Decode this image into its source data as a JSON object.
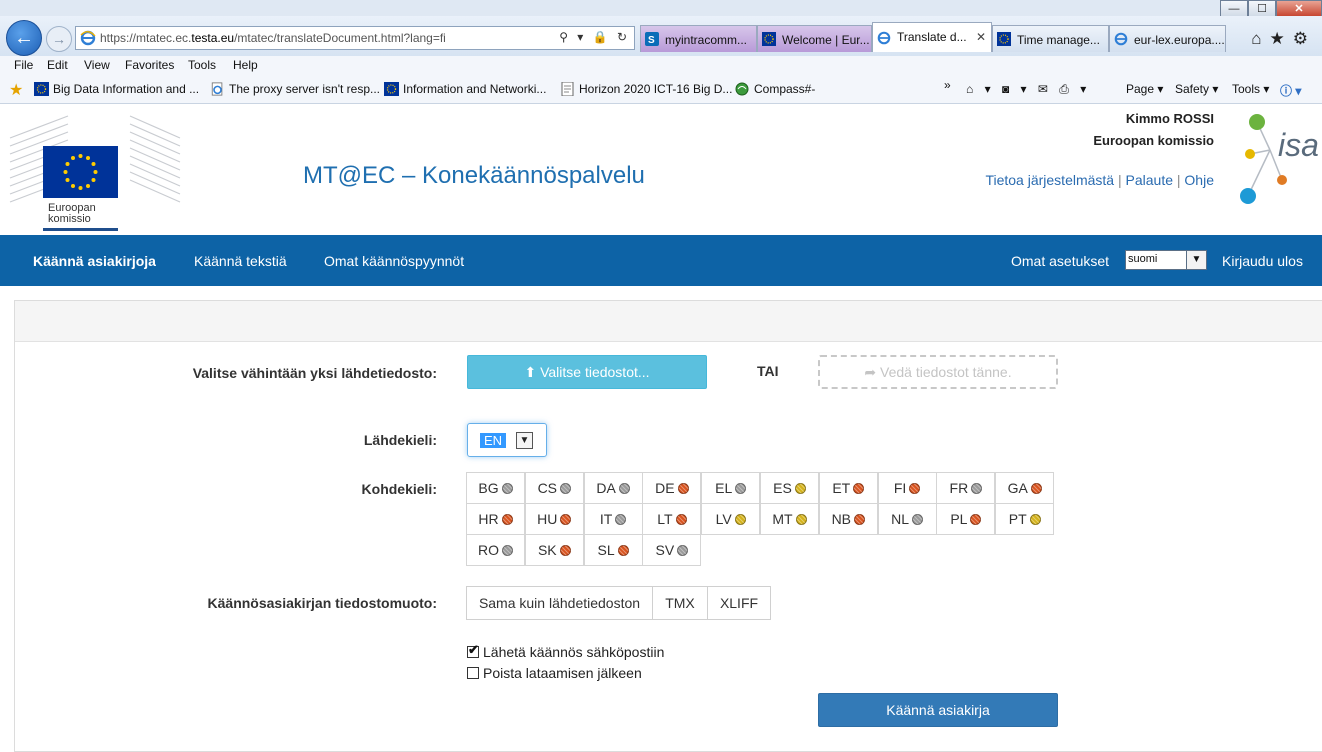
{
  "browser": {
    "url_prefix": "https://mtatec.ec.",
    "url_host": "testa.eu",
    "url_rest": "/mtatec/translateDocument.html?lang=fi",
    "addr_icons": "⚲ ▾ 🔒 ↻",
    "tabs": [
      {
        "label": "myintracomm...",
        "style": "purple",
        "fav": "sharepoint"
      },
      {
        "label": "Welcome | Eur...",
        "style": "purple",
        "fav": "eu"
      },
      {
        "label": "Translate d...",
        "style": "active",
        "fav": "ie",
        "close": "✕"
      },
      {
        "label": "Time manage...",
        "style": "normal",
        "fav": "eu"
      },
      {
        "label": "eur-lex.europa....",
        "style": "normal",
        "fav": "ie"
      }
    ],
    "window_buttons": {
      "minimize": "—",
      "maximize": "☐",
      "close": "✕"
    },
    "right_tools": "⌂★⚙",
    "menu": [
      "File",
      "Edit",
      "View",
      "Favorites",
      "Tools",
      "Help"
    ],
    "favorites": [
      {
        "label": "Big Data Information and ...",
        "icon": "eu"
      },
      {
        "label": "The proxy server isn't resp...",
        "icon": "ie"
      },
      {
        "label": "Information and Networki...",
        "icon": "eu"
      },
      {
        "label": "Horizon 2020 ICT-16 Big D...",
        "icon": "doc"
      },
      {
        "label": "Compass#-",
        "icon": "globe"
      }
    ],
    "chevron": "»",
    "command_bar": [
      "Page ▾",
      "Safety ▾",
      "Tools ▾"
    ],
    "command_icons": "⌂ ▾ ◙ ▾ ✉ ⎙ ▾"
  },
  "header": {
    "ec_logo_text": [
      "Euroopan",
      "komissio"
    ],
    "title": "MT@EC – Konekäännöspalvelu",
    "user_name": "Kimmo ROSSI",
    "user_org": "Euroopan komissio",
    "links": [
      "Tietoa järjestelmästä",
      "Palaute",
      "Ohje"
    ],
    "link_sep": "|",
    "isa_logo_text": "isa"
  },
  "nav": {
    "items": [
      "Käännä asiakirjoja",
      "Käännä tekstiä",
      "Omat käännöspyynnöt"
    ],
    "settings": "Omat asetukset",
    "language": "suomi",
    "logout": "Kirjaudu ulos"
  },
  "form": {
    "source_file_label": "Valitse vähintään yksi lähdetiedosto:",
    "choose_files": "Valitse tiedostot...",
    "choose_icon": "⬆",
    "or": "TAI",
    "drop_zone": "Vedä tiedostot tänne.",
    "drop_icon": "➦",
    "source_lang_label": "Lähdekieli:",
    "source_lang": "EN",
    "target_lang_label": "Kohdekieli:",
    "target_langs": [
      {
        "code": "BG",
        "badge": "grey"
      },
      {
        "code": "CS",
        "badge": "grey"
      },
      {
        "code": "DA",
        "badge": "grey"
      },
      {
        "code": "DE",
        "badge": "red"
      },
      {
        "code": "EL",
        "badge": "grey"
      },
      {
        "code": "ES",
        "badge": "gold"
      },
      {
        "code": "ET",
        "badge": "red"
      },
      {
        "code": "FI",
        "badge": "red"
      },
      {
        "code": "FR",
        "badge": "grey"
      },
      {
        "code": "GA",
        "badge": "red"
      },
      {
        "code": "HR",
        "badge": "red"
      },
      {
        "code": "HU",
        "badge": "red"
      },
      {
        "code": "IT",
        "badge": "grey"
      },
      {
        "code": "LT",
        "badge": "red"
      },
      {
        "code": "LV",
        "badge": "gold"
      },
      {
        "code": "MT",
        "badge": "gold"
      },
      {
        "code": "NB",
        "badge": "red"
      },
      {
        "code": "NL",
        "badge": "grey"
      },
      {
        "code": "PL",
        "badge": "red"
      },
      {
        "code": "PT",
        "badge": "gold"
      },
      {
        "code": "RO",
        "badge": "grey"
      },
      {
        "code": "SK",
        "badge": "red"
      },
      {
        "code": "SL",
        "badge": "red"
      },
      {
        "code": "SV",
        "badge": "grey"
      }
    ],
    "format_label": "Käännösasiakirjan tiedostomuoto:",
    "formats": [
      "Sama kuin lähdetiedoston",
      "TMX",
      "XLIFF"
    ],
    "send_email_label": "Lähetä käännös sähköpostiin",
    "send_email_checked": true,
    "delete_after_label": "Poista lataamisen jälkeen",
    "delete_after_checked": false,
    "submit": "Käännä asiakirja"
  },
  "colors": {
    "nav_bg": "#0d63a6",
    "title": "#1f6fb0",
    "info_btn": "#5bc0de",
    "primary_btn": "#337ab7",
    "badge_grey": "#9a9a9a",
    "badge_red": "#d9531e",
    "badge_gold": "#d4b21a"
  }
}
